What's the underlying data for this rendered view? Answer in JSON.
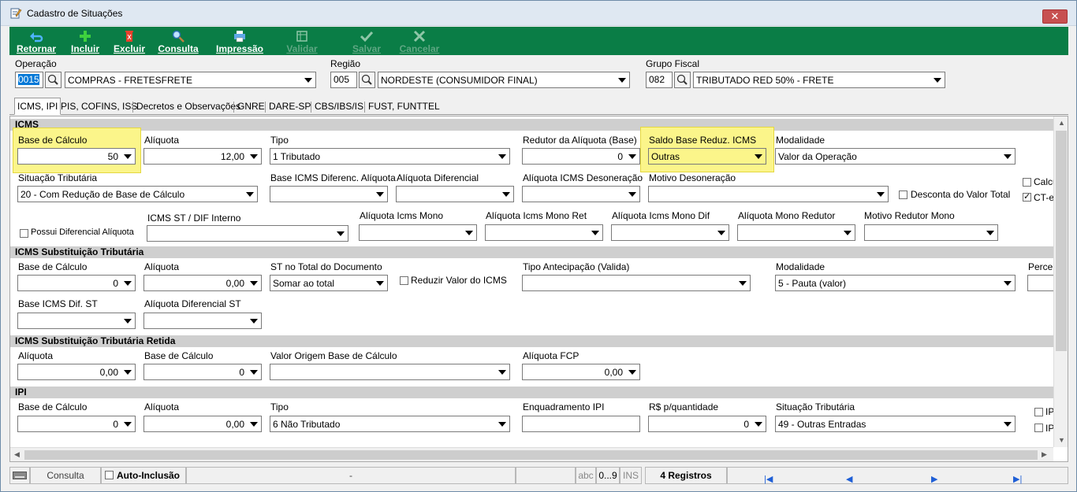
{
  "window": {
    "title": "Cadastro de Situações",
    "close_icon": "close-icon"
  },
  "toolbar": {
    "retornar": "Retornar",
    "incluir": "Incluir",
    "excluir": "Excluir",
    "consulta": "Consulta",
    "impressao": "Impressão",
    "validar": "Validar",
    "salvar": "Salvar",
    "cancelar": "Cancelar"
  },
  "header": {
    "operacao": {
      "label": "Operação",
      "code": "0015",
      "value": "COMPRAS - FRETESFRETE"
    },
    "regiao": {
      "label": "Região",
      "code": "005",
      "value": "NORDESTE (CONSUMIDOR FINAL)"
    },
    "grupo": {
      "label": "Grupo Fiscal",
      "code": "082",
      "value": "TRIBUTADO RED 50%  - FRETE"
    }
  },
  "tabs": [
    "ICMS, IPI",
    "PIS, COFINS, ISS",
    "Decretos e Observações",
    "GNRE",
    "DARE-SP",
    "CBS/IBS/IS",
    "FUST, FUNTTEL"
  ],
  "icms": {
    "section": "ICMS",
    "base_calculo": {
      "label": "Base de Cálculo",
      "value": "50"
    },
    "aliquota": {
      "label": "Alíquota",
      "value": "12,00"
    },
    "tipo": {
      "label": "Tipo",
      "value": "1 Tributado"
    },
    "redutor": {
      "label": "Redutor da Alíquota (Base)",
      "value": "0"
    },
    "saldo": {
      "label": "Saldo Base Reduz. ICMS",
      "value": "Outras"
    },
    "modalidade": {
      "label": "Modalidade",
      "value": "Valor da Operação"
    },
    "situacao": {
      "label": "Situação Tributária",
      "value": "20 - Com Redução de Base de Cálculo"
    },
    "base_difer": {
      "label": "Base ICMS Diferenc. Alíquota",
      "value": ""
    },
    "aliq_difer": {
      "label": "Alíquota Diferencial",
      "value": ""
    },
    "aliq_deson": {
      "label": "Alíquota ICMS Desoneração",
      "value": ""
    },
    "motivo_deson": {
      "label": "Motivo Desoneração",
      "value": ""
    },
    "desconta": "Desconta do Valor Total",
    "calc": "Calcu",
    "cte": "CT-e",
    "possui_dif": "Possui Diferencial Alíquota",
    "st_dif": {
      "label": "ICMS ST / DIF Interno",
      "value": ""
    },
    "aliq_mono": {
      "label": "Alíquota Icms Mono",
      "value": ""
    },
    "aliq_mono_ret": {
      "label": "Alíquota Icms Mono Ret",
      "value": ""
    },
    "aliq_mono_dif": {
      "label": "Alíquota Icms Mono Dif",
      "value": ""
    },
    "aliq_mono_red": {
      "label": "Alíquota Mono Redutor",
      "value": ""
    },
    "motivo_red_mono": {
      "label": "Motivo Redutor Mono",
      "value": ""
    }
  },
  "st": {
    "section": "ICMS Substituição Tributária",
    "base_calculo": {
      "label": "Base de Cálculo",
      "value": "0"
    },
    "aliquota": {
      "label": "Alíquota",
      "value": "0,00"
    },
    "st_total": {
      "label": "ST no Total do Documento",
      "value": "Somar ao total"
    },
    "reduzir": "Reduzir Valor do ICMS",
    "tipo_antec": {
      "label": "Tipo Antecipação (Valida)",
      "value": ""
    },
    "modalidade": {
      "label": "Modalidade",
      "value": "5 - Pauta (valor)"
    },
    "percen": "Percen",
    "base_dif_st": {
      "label": "Base ICMS Dif. ST",
      "value": ""
    },
    "aliq_dif_st": {
      "label": "Alíquota Diferencial ST",
      "value": ""
    }
  },
  "st_retida": {
    "section": "ICMS Substituição Tributária Retida",
    "aliquota": {
      "label": "Alíquota",
      "value": "0,00"
    },
    "base_calculo": {
      "label": "Base de Cálculo",
      "value": "0"
    },
    "valor_origem": {
      "label": "Valor Origem Base de Cálculo",
      "value": ""
    },
    "aliq_fcp": {
      "label": "Alíquota FCP",
      "value": "0,00"
    }
  },
  "ipi": {
    "section": "IPI",
    "base_calculo": {
      "label": "Base de Cálculo",
      "value": "0"
    },
    "aliquota": {
      "label": "Alíquota",
      "value": "0,00"
    },
    "tipo": {
      "label": "Tipo",
      "value": "6 Não Tributado"
    },
    "enquadramento": {
      "label": "Enquadramento IPI",
      "value": ""
    },
    "rs_qtd": {
      "label": "R$ p/quantidade",
      "value": "0"
    },
    "situacao": {
      "label": "Situação Tributária",
      "value": "49 - Outras Entradas"
    },
    "ip1": "IP",
    "ip2": "IP"
  },
  "status": {
    "consulta": "Consulta",
    "auto_inclusao": "Auto-Inclusão",
    "dash": "-",
    "abc": "abc",
    "range": "0...9",
    "ins": "INS",
    "registros": "4 Registros"
  }
}
